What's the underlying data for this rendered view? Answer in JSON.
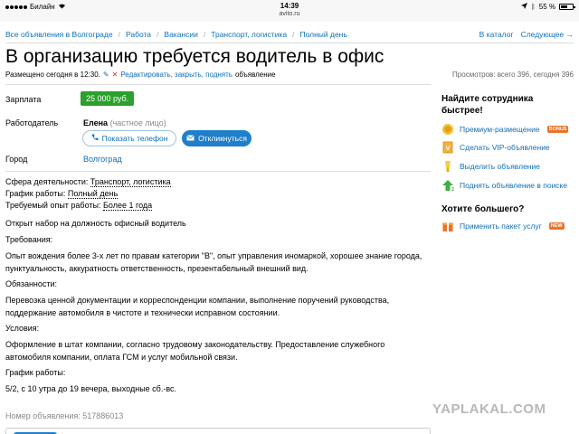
{
  "status_bar": {
    "carrier": "Билайн",
    "time": "14:39",
    "url": "avito.ru",
    "battery": "55 %"
  },
  "breadcrumbs": {
    "items": [
      "Все объявления в Волгограде",
      "Работа",
      "Вакансии",
      "Транспорт, логистика",
      "Полный день"
    ],
    "catalog": "В каталог",
    "next": "Следующее →"
  },
  "listing": {
    "title": "В организацию требуется водитель в офис",
    "posted": "Размещено сегодня в 12:30.",
    "edit_link": "Редактировать, закрыть, поднять",
    "edit_suffix": "объявление",
    "views": "Просмотров: всего 396, сегодня 396"
  },
  "fields": {
    "salary_label": "Зарплата",
    "salary_value": "25 000 руб.",
    "employer_label": "Работодатель",
    "employer_name": "Елена",
    "employer_type": "(частное лицо)",
    "show_phone": "Показать телефон",
    "reply": "Откликнуться",
    "city_label": "Город",
    "city_value": "Волгоград"
  },
  "params": {
    "sphere_label": "Сфера деятельности:",
    "sphere_value": "Транспорт, логистика",
    "schedule_label": "График работы:",
    "schedule_value": "Полный день",
    "experience_label": "Требуемый опыт работы:",
    "experience_value": "Более 1 года"
  },
  "description": {
    "intro": "Открыт набор на должность офисный водитель",
    "req_title": "Требования:",
    "req_text": "Опыт вождения более 3-х лет по правам категории \"В\", опыт управления иномаркой, хорошее знание города, пунктуальность, аккуратность ответственность, презентабельный внешний вид.",
    "duties_title": "Обязанности:",
    "duties_text": "Перевозка ценной документации и корреспонденции компании, выполнение поручений руководства, поддержание автомобиля в чистоте и технически исправном состоянии.",
    "cond_title": "Условия:",
    "cond_text": "Оформление в штат компании, согласно трудовому законодательству. Предоставление служебного автомобиля компании, оплата ГСМ и услуг мобильной связи.",
    "sched_title": "График работы:",
    "sched_text": "5/2, с 10 утра до 19 вечера, выходные сб.-вс."
  },
  "ad_number": "Номер объявления: 517886013",
  "sidebar": {
    "find_title_1": "Найдите сотрудника",
    "find_title_2": "быстрее!",
    "items": [
      {
        "label": "Премиум-размещение",
        "badge": "BONUS"
      },
      {
        "label": "Сделать VIP-объявление"
      },
      {
        "label": "Выделить объявление"
      },
      {
        "label": "Поднять объявление в поиске"
      }
    ],
    "more_title": "Хотите большего?",
    "package": {
      "label": "Применить пакет услуг",
      "badge": "NEW"
    }
  },
  "watermark": "YAPLAKAL.COM",
  "colors": {
    "link": "#0f6fb7",
    "price_bg": "#2ca02c",
    "reply_btn": "#1f7fcb",
    "bonus_badge": "#e8742a",
    "new_badge": "#e8742a"
  }
}
